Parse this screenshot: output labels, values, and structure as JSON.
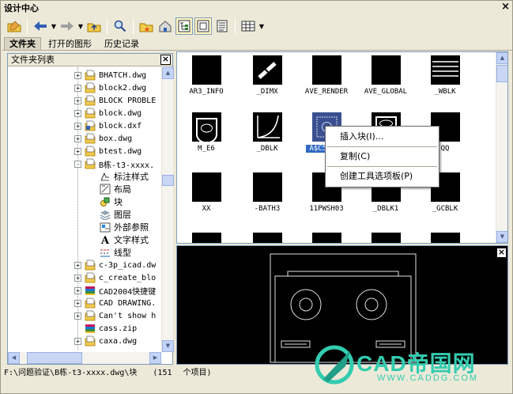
{
  "window": {
    "title": "设计中心",
    "close": "×"
  },
  "tabs": [
    {
      "label": "文件夹",
      "active": true
    },
    {
      "label": "打开的图形",
      "active": false
    },
    {
      "label": "历史记录",
      "active": false
    }
  ],
  "folder_list": {
    "header": "文件夹列表",
    "close": "×",
    "items": [
      {
        "label": "BHATCH.dwg",
        "icon": "dwg-file-icon",
        "expander": "+"
      },
      {
        "label": "block2.dwg",
        "icon": "dwg-file-icon",
        "expander": "+"
      },
      {
        "label": "BLOCK PROBLE",
        "icon": "dwg-file-icon",
        "expander": "+"
      },
      {
        "label": "block.dwg",
        "icon": "dwg-file-icon",
        "expander": "+"
      },
      {
        "label": "block.dxf",
        "icon": "dxf-file-icon",
        "expander": "+"
      },
      {
        "label": "box.dwg",
        "icon": "dwg-file-icon",
        "expander": "+"
      },
      {
        "label": "btest.dwg",
        "icon": "dwg-file-icon",
        "expander": "+"
      },
      {
        "label": "B栋-t3-xxxx.",
        "icon": "dwg-file-icon",
        "expander": "-"
      },
      {
        "label": "标注样式",
        "icon": "dimstyle-icon",
        "expander": ""
      },
      {
        "label": "布局",
        "icon": "layout-icon",
        "expander": ""
      },
      {
        "label": "块",
        "icon": "block-icon",
        "expander": ""
      },
      {
        "label": "图层",
        "icon": "layer-icon",
        "expander": ""
      },
      {
        "label": "外部参照",
        "icon": "xref-icon",
        "expander": ""
      },
      {
        "label": "文字样式",
        "icon": "textstyle-icon",
        "expander": ""
      },
      {
        "label": "线型",
        "icon": "linetype-icon",
        "expander": ""
      },
      {
        "label": "c-3p_icad.dw",
        "icon": "dwg-file-icon",
        "expander": "+"
      },
      {
        "label": "c_create_blo",
        "icon": "dwg-file-icon",
        "expander": "+"
      },
      {
        "label": "CAD2004快捷键",
        "icon": "archive-icon",
        "expander": "+"
      },
      {
        "label": "CAD DRAWING.",
        "icon": "dwg-file-icon",
        "expander": "+"
      },
      {
        "label": "Can't show h",
        "icon": "dwg-file-icon",
        "expander": "+"
      },
      {
        "label": "cass.zip",
        "icon": "archive-icon",
        "expander": ""
      },
      {
        "label": "caxa.dwg",
        "icon": "dwg-file-icon",
        "expander": "+"
      }
    ]
  },
  "blocks": [
    {
      "label": "AR3_INFO",
      "icon": "black-square"
    },
    {
      "label": "_DIMX",
      "icon": "diagonal-tick"
    },
    {
      "label": "AVE_RENDER",
      "icon": "black-square"
    },
    {
      "label": "AVE_GLOBAL",
      "icon": "black-square"
    },
    {
      "label": "_WBLK",
      "icon": "stripes"
    },
    {
      "label": "M_E6",
      "icon": "sink"
    },
    {
      "label": "_DBLK",
      "icon": "curve"
    },
    {
      "label": "A$C5E...",
      "icon": "pattern"
    },
    {
      "label": "",
      "icon": "sink2"
    },
    {
      "label": "QQ",
      "icon": "black-square"
    },
    {
      "label": "XX",
      "icon": "black-square"
    },
    {
      "label": "-BATH3",
      "icon": "black-square"
    },
    {
      "label": "11PWSH03",
      "icon": "black-square"
    },
    {
      "label": "_DBLK1",
      "icon": "black-square"
    },
    {
      "label": "_GCBLK",
      "icon": "black-square"
    }
  ],
  "context_menu": {
    "items": [
      "插入块(I)...",
      "复制(C)",
      "创建工具选项板(P)"
    ]
  },
  "preview": {
    "close": "×"
  },
  "status": {
    "path": "F:\\问题验证\\B栋-t3-xxxx.dwg\\块",
    "count": "(151",
    "unit": "个项目)"
  },
  "watermark": {
    "brand": "CAD帝国网",
    "url": "WWW.CADDG.COM"
  },
  "colors": {
    "accent": "#33ccb0",
    "selection": "#316ac5",
    "window_bg": "#ece9d8"
  }
}
